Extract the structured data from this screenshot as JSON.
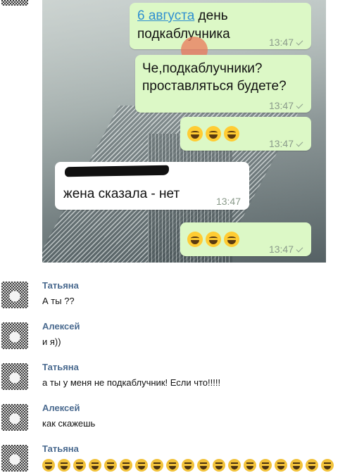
{
  "chat_image": {
    "messages": [
      {
        "link": "6 августа",
        "text": " день",
        "text2": "подкаблучника",
        "time": "13:47"
      },
      {
        "text": "Че,подкаблучники?",
        "text2": "проставляться будете?",
        "time": "13:47"
      },
      {
        "emoji": "face-with-tears-of-joy x3",
        "time": "13:47"
      },
      {
        "text": "жена сказала - нет",
        "time": "13:47"
      },
      {
        "emoji": "face-with-tears-of-joy x3",
        "time": "13:47"
      }
    ]
  },
  "chat": [
    {
      "author": "Татьяна",
      "text": "А ты ??"
    },
    {
      "author": "Алексей",
      "text": "и я))"
    },
    {
      "author": "Татьяна",
      "text": "а ты у меня не подкаблучник! Если что!!!!!"
    },
    {
      "author": "Алексей",
      "text": "как скажешь"
    },
    {
      "author": "Татьяна",
      "emoji": "laughing-face x19"
    }
  ],
  "colors": {
    "outgoing_bubble": "#dcf8c6",
    "incoming_bubble": "#ffffff",
    "author_name": "#4a6a8f"
  }
}
